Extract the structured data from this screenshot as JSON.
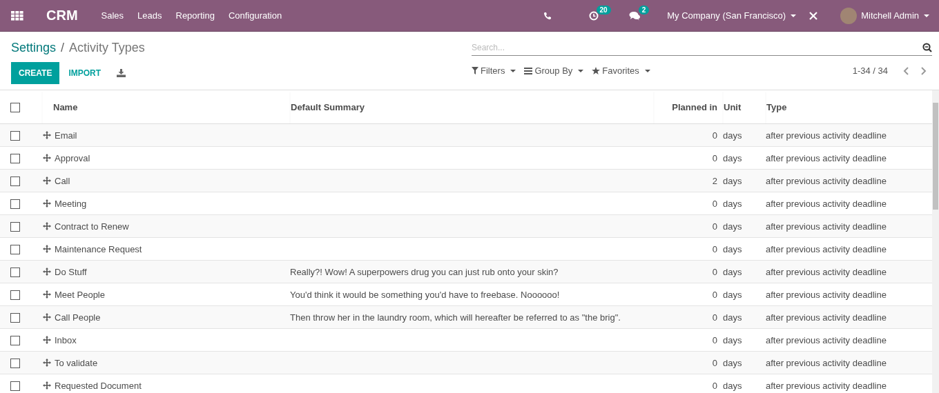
{
  "navbar": {
    "app_name": "CRM",
    "menu": [
      "Sales",
      "Leads",
      "Reporting",
      "Configuration"
    ],
    "activity_count": "20",
    "message_count": "2",
    "company": "My Company (San Francisco)",
    "user": "Mitchell Admin"
  },
  "breadcrumb": {
    "parent": "Settings",
    "separator": "/",
    "current": "Activity Types"
  },
  "buttons": {
    "create": "CREATE",
    "import": "IMPORT"
  },
  "search": {
    "placeholder": "Search..."
  },
  "filters": [
    "Filters",
    "Group By",
    "Favorites"
  ],
  "pager": "1-34 / 34",
  "table": {
    "columns": [
      "Name",
      "Default Summary",
      "Planned in",
      "Unit",
      "Type"
    ],
    "all_checked": false,
    "rows": [
      {
        "name": "Email",
        "summary": "",
        "planned": "0",
        "unit": "days",
        "type": "after previous activity deadline",
        "checked": false
      },
      {
        "name": "Approval",
        "summary": "",
        "planned": "0",
        "unit": "days",
        "type": "after previous activity deadline",
        "checked": false
      },
      {
        "name": "Call",
        "summary": "",
        "planned": "2",
        "unit": "days",
        "type": "after previous activity deadline",
        "checked": false
      },
      {
        "name": "Meeting",
        "summary": "",
        "planned": "0",
        "unit": "days",
        "type": "after previous activity deadline",
        "checked": false
      },
      {
        "name": "Contract to Renew",
        "summary": "",
        "planned": "0",
        "unit": "days",
        "type": "after previous activity deadline",
        "checked": false
      },
      {
        "name": "Maintenance Request",
        "summary": "",
        "planned": "0",
        "unit": "days",
        "type": "after previous activity deadline",
        "checked": false
      },
      {
        "name": "Do Stuff",
        "summary": "Really?! Wow! A superpowers drug you can just rub onto your skin?",
        "planned": "0",
        "unit": "days",
        "type": "after previous activity deadline",
        "checked": false
      },
      {
        "name": "Meet People",
        "summary": "You'd think it would be something you'd have to freebase. Noooooo!",
        "planned": "0",
        "unit": "days",
        "type": "after previous activity deadline",
        "checked": false
      },
      {
        "name": "Call People",
        "summary": "Then throw her in the laundry room, which will hereafter be referred to as \"the brig\".",
        "planned": "0",
        "unit": "days",
        "type": "after previous activity deadline",
        "checked": false
      },
      {
        "name": "Inbox",
        "summary": "",
        "planned": "0",
        "unit": "days",
        "type": "after previous activity deadline",
        "checked": false
      },
      {
        "name": "To validate",
        "summary": "",
        "planned": "0",
        "unit": "days",
        "type": "after previous activity deadline",
        "checked": false
      },
      {
        "name": "Requested Document",
        "summary": "",
        "planned": "0",
        "unit": "days",
        "type": "after previous activity deadline",
        "checked": false
      }
    ]
  }
}
